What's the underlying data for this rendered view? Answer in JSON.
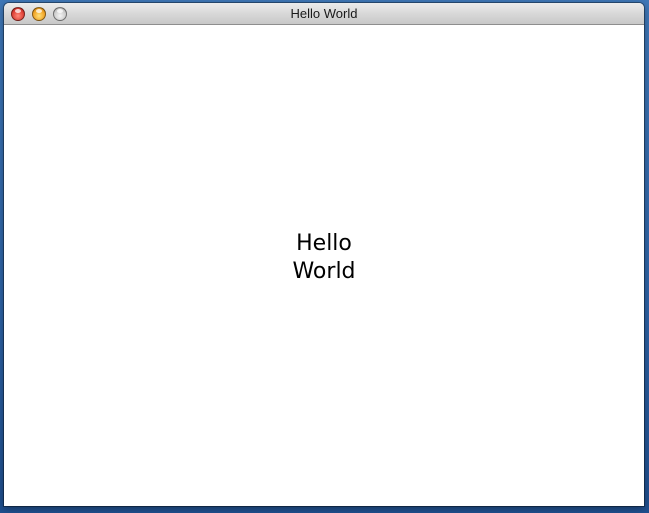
{
  "window": {
    "title": "Hello World",
    "controls": {
      "close_icon": "close-traffic-light",
      "minimize_icon": "minimize-traffic-light",
      "zoom_icon": "zoom-traffic-light"
    }
  },
  "content": {
    "line1": "Hello",
    "line2": "World"
  },
  "colors": {
    "close": "#e0443a",
    "minimize": "#f2a72a",
    "zoom": "#cfcfcf",
    "desktop": "#2d63a6"
  }
}
